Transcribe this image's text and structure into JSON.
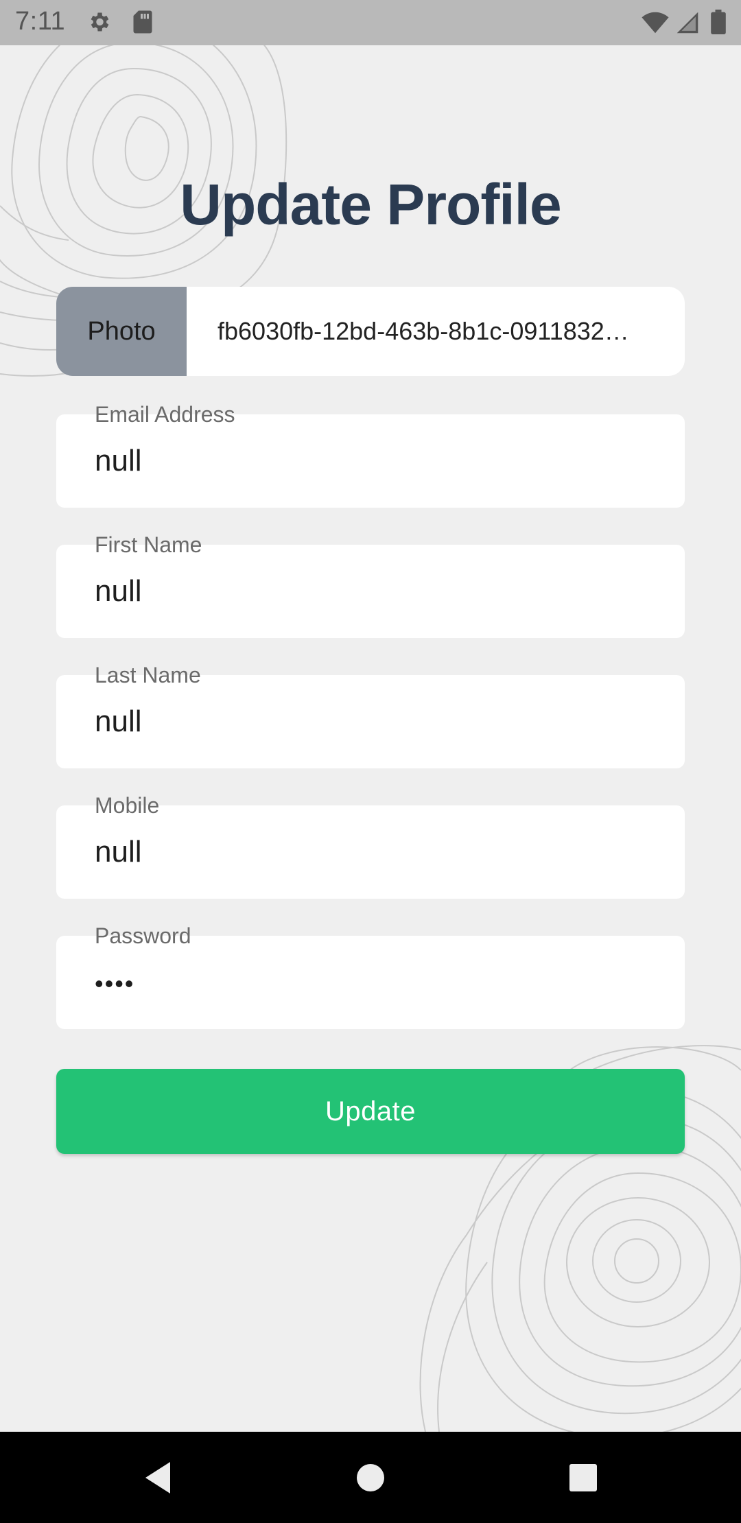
{
  "status_bar": {
    "time": "7:11",
    "icons": [
      "gear-icon",
      "sd-card-icon",
      "wifi-icon",
      "signal-icon",
      "battery-icon"
    ]
  },
  "page": {
    "title": "Update Profile"
  },
  "photo": {
    "button_label": "Photo",
    "filename": "fb6030fb-12bd-463b-8b1c-0911832…"
  },
  "fields": {
    "email": {
      "label": "Email Address",
      "value": "null"
    },
    "first_name": {
      "label": "First Name",
      "value": "null"
    },
    "last_name": {
      "label": "Last Name",
      "value": "null"
    },
    "mobile": {
      "label": "Mobile",
      "value": "null"
    },
    "password": {
      "label": "Password",
      "value": "••••"
    }
  },
  "actions": {
    "update_label": "Update"
  },
  "nav_bar": {
    "icons": [
      "back-icon",
      "home-icon",
      "recents-icon"
    ]
  },
  "colors": {
    "background": "#efefef",
    "title": "#2b3b51",
    "photo_button": "#8b939e",
    "primary": "#23c275",
    "status_bar": "#b9b9b9",
    "nav_bar": "#000000"
  }
}
